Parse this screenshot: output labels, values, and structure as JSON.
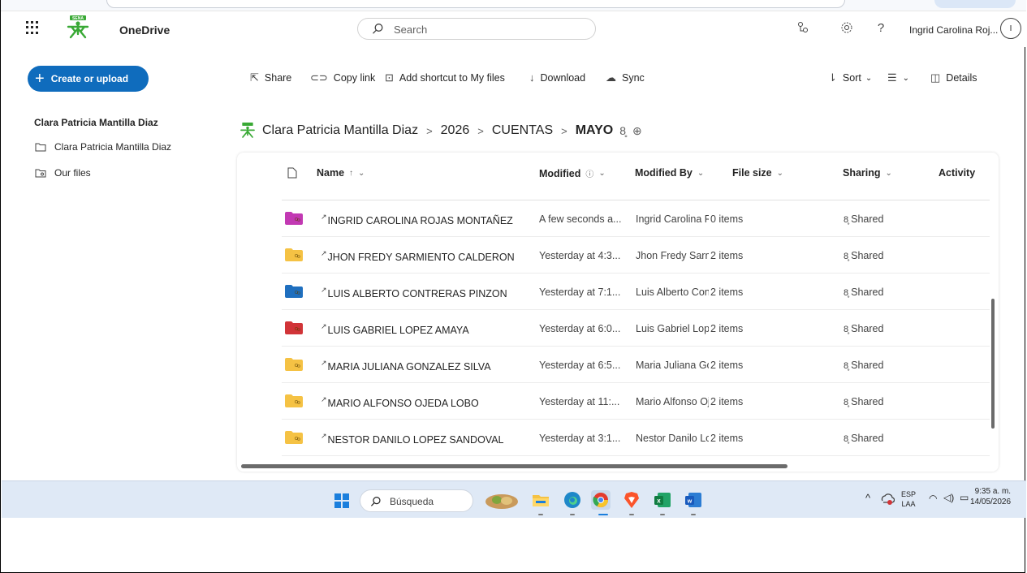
{
  "header": {
    "app_name": "OneDrive",
    "search_placeholder": "Search",
    "user_name": "Ingrid Carolina Roj...",
    "avatar_initial": "I"
  },
  "nav": {
    "create_label": "Create or upload",
    "owner": "Clara Patricia Mantilla Diaz",
    "items": [
      {
        "label": "Clara Patricia Mantilla Diaz",
        "icon": "folder-icon"
      },
      {
        "label": "Our files",
        "icon": "shared-files-icon"
      }
    ]
  },
  "commands": {
    "share": "Share",
    "copy_link": "Copy link",
    "add_shortcut": "Add shortcut to My files",
    "download": "Download",
    "sync": "Sync",
    "sort": "Sort",
    "details": "Details"
  },
  "breadcrumb": {
    "root": "Clara Patricia Mantilla Diaz",
    "sep": ">",
    "level1": "2026",
    "level2": "CUENTAS",
    "current": "MAYO"
  },
  "columns": {
    "name": "Name",
    "name_sort": "↑",
    "modified": "Modified",
    "modified_by": "Modified By",
    "file_size": "File size",
    "sharing": "Sharing",
    "activity": "Activity"
  },
  "rows": [
    {
      "name": "INGRID CAROLINA ROJAS MONTAÑEZ",
      "modified": "A few seconds a...",
      "modified_by": "Ingrid Carolina Roja",
      "size": "0 items",
      "sharing": "Shared",
      "color": "#c239b3"
    },
    {
      "name": "JHON FREDY SARMIENTO CALDERON",
      "modified": "Yesterday at 4:3...",
      "modified_by": "Jhon Fredy Sarmien",
      "size": "2 items",
      "sharing": "Shared",
      "color": "#f5c244"
    },
    {
      "name": "LUIS ALBERTO CONTRERAS PINZON",
      "modified": "Yesterday at 7:1...",
      "modified_by": "Luis Alberto Contre",
      "size": "2 items",
      "sharing": "Shared",
      "color": "#1f6fbf"
    },
    {
      "name": "LUIS GABRIEL LOPEZ AMAYA",
      "modified": "Yesterday at 6:0...",
      "modified_by": "Luis Gabriel Lopez A",
      "size": "2 items",
      "sharing": "Shared",
      "color": "#d13438"
    },
    {
      "name": "MARIA JULIANA GONZALEZ SILVA",
      "modified": "Yesterday at 6:5...",
      "modified_by": "Maria Juliana Gonz",
      "size": "2 items",
      "sharing": "Shared",
      "color": "#f5c244"
    },
    {
      "name": "MARIO ALFONSO OJEDA LOBO",
      "modified": "Yesterday at 11:...",
      "modified_by": "Mario Alfonso Ojec",
      "size": "2 items",
      "sharing": "Shared",
      "color": "#f5c244"
    },
    {
      "name": "NESTOR DANILO LOPEZ SANDOVAL",
      "modified": "Yesterday at 3:1...",
      "modified_by": "Nestor Danilo Lope",
      "size": "2 items",
      "sharing": "Shared",
      "color": "#f5c244"
    }
  ],
  "taskbar": {
    "search_text": "Búsqueda",
    "lang_top": "ESP",
    "lang_bottom": "LAA",
    "time": "9:35 a. m.",
    "date": "14/05/2026"
  },
  "colors": {
    "accent": "#0f6cbd",
    "sena_green": "#39a935"
  }
}
